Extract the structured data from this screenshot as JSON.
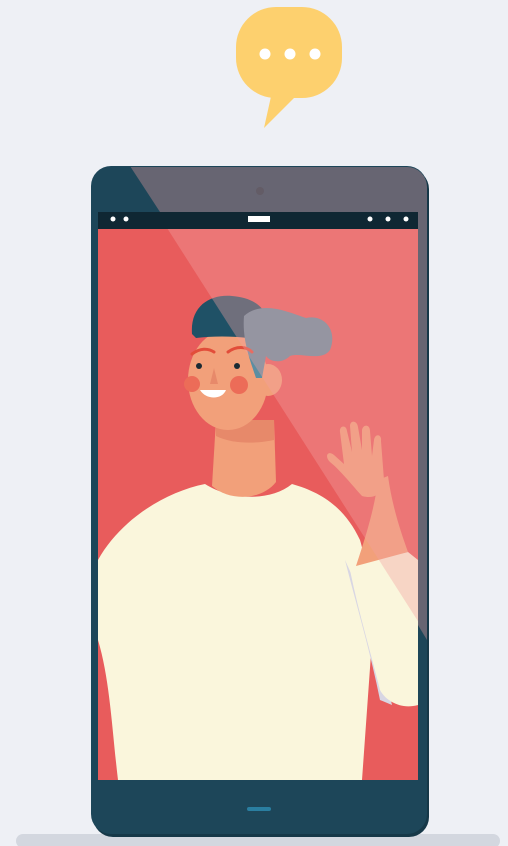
{
  "scene": {
    "description_visible_text": "",
    "icons": {
      "chat_bubble": "speech-bubble-icon",
      "typing_indicator": "ellipsis-icon",
      "camera": "camera-icon",
      "home_button": "home-indicator-icon"
    },
    "colors": {
      "background": "#eef0f5",
      "phone_body": "#1d4659",
      "phone_edge": "#163848",
      "status_bar": "#0f2733",
      "screen_background": "#e85c5c",
      "screen_glare": "#f3a0a0",
      "chat_bubble": "#fdd06e",
      "typing_dots": "#ffffff",
      "skin": "#f2a07a",
      "skin_shadow": "#e7896a",
      "hair": "#1f5166",
      "hair_light": "#5c8ea2",
      "sweater": "#faf6dc",
      "sweater_shadow": "#d8d6e3",
      "cheeks": "#ec6c58",
      "brows": "#e24d3a",
      "floor_shadow": "#d3d7df"
    },
    "status_bar": {
      "left_dots": 2,
      "right_dots": 3
    }
  }
}
